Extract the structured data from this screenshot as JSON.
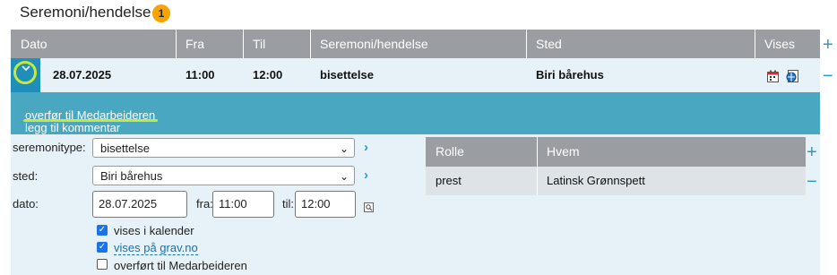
{
  "section": {
    "title": "Seremoni/hendelse",
    "count": "1"
  },
  "table": {
    "columns": [
      "Dato",
      "Fra",
      "Til",
      "Seremoni/hendelse",
      "Sted",
      "Vises"
    ],
    "add_symbol": "+",
    "remove_symbol": "−",
    "row": {
      "dato": "28.07.2025",
      "fra": "11:00",
      "til": "12:00",
      "seremoni": "bisettelse",
      "sted": "Biri bårehus"
    }
  },
  "actions": {
    "transfer": "overfør til Medarbeideren",
    "comment": "legg til kommentar"
  },
  "form": {
    "seremonitype_label": "seremonitype:",
    "seremonitype_value": "bisettelse",
    "sted_label": "sted:",
    "sted_value": "Biri bårehus",
    "dato_label": "dato:",
    "dato_value": "28.07.2025",
    "fra_label": "fra:",
    "fra_value": "11:00",
    "til_label": "til:",
    "til_value": "12:00",
    "checkboxes": [
      {
        "label": "vises i kalender",
        "checked": true
      },
      {
        "label": "vises på grav.no",
        "checked": true
      },
      {
        "label": "overført til Medarbeideren",
        "checked": false
      }
    ]
  },
  "roles": {
    "columns": [
      "Rolle",
      "Hvem"
    ],
    "rows": [
      {
        "rolle": "prest",
        "hvem": "Latinsk Grønnspett"
      }
    ]
  },
  "colors": {
    "header_bg": "#9a9ea3",
    "row_bg": "#e7f2f8",
    "action_band": "#4aa7c2",
    "accent": "#2a9ac4",
    "badge": "#f7a400",
    "highlight": "#c6e83b"
  }
}
